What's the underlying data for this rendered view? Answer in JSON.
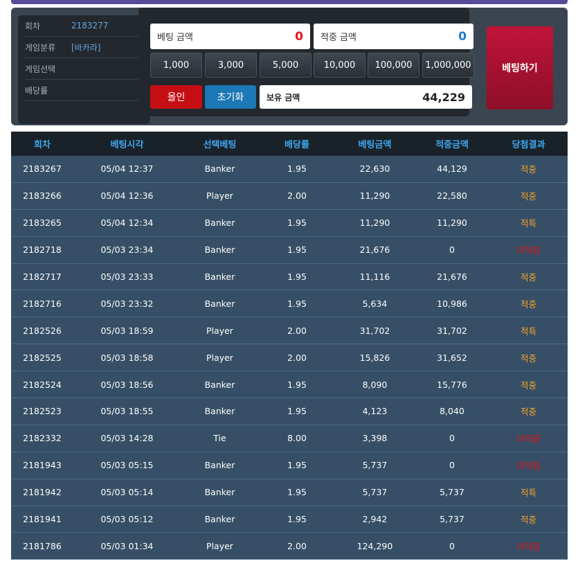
{
  "colors": {
    "accent": "#3ea7f0",
    "win": "#f3a12a",
    "lose": "#e3141e",
    "bet_button": "#b0102f"
  },
  "info": {
    "rows": [
      {
        "label": "회차",
        "value": "2183277"
      },
      {
        "label": "게임분류",
        "value": "[바카라]"
      },
      {
        "label": "게임선택",
        "value": ""
      },
      {
        "label": "배당률",
        "value": ""
      }
    ]
  },
  "bet_amount": {
    "label": "베팅 금액",
    "value": "0"
  },
  "win_amount": {
    "label": "적중 금액",
    "value": "0"
  },
  "chips": [
    "1,000",
    "3,000",
    "5,000",
    "10,000",
    "100,000",
    "1,000,000"
  ],
  "buttons": {
    "allin": "올인",
    "reset": "초기화",
    "place_bet": "베팅하기"
  },
  "holding": {
    "label": "보유 금액",
    "value": "44,229"
  },
  "history": {
    "columns": [
      "회차",
      "베팅시각",
      "선택베팅",
      "배당률",
      "베팅금액",
      "적중금액",
      "당첨결과"
    ],
    "rows": [
      [
        "2183267",
        "05/04 12:37",
        "Banker",
        "1.95",
        "22,630",
        "44,129",
        "적중"
      ],
      [
        "2183266",
        "05/04 12:36",
        "Player",
        "2.00",
        "11,290",
        "22,580",
        "적중"
      ],
      [
        "2183265",
        "05/04 12:34",
        "Banker",
        "1.95",
        "11,290",
        "11,290",
        "적특"
      ],
      [
        "2182718",
        "05/03 23:34",
        "Banker",
        "1.95",
        "21,676",
        "0",
        "미적중"
      ],
      [
        "2182717",
        "05/03 23:33",
        "Banker",
        "1.95",
        "11,116",
        "21,676",
        "적중"
      ],
      [
        "2182716",
        "05/03 23:32",
        "Banker",
        "1.95",
        "5,634",
        "10,986",
        "적중"
      ],
      [
        "2182526",
        "05/03 18:59",
        "Player",
        "2.00",
        "31,702",
        "31,702",
        "적특"
      ],
      [
        "2182525",
        "05/03 18:58",
        "Player",
        "2.00",
        "15,826",
        "31,652",
        "적중"
      ],
      [
        "2182524",
        "05/03 18:56",
        "Banker",
        "1.95",
        "8,090",
        "15,776",
        "적중"
      ],
      [
        "2182523",
        "05/03 18:55",
        "Banker",
        "1.95",
        "4,123",
        "8,040",
        "적중"
      ],
      [
        "2182332",
        "05/03 14:28",
        "Tie",
        "8.00",
        "3,398",
        "0",
        "미적중"
      ],
      [
        "2181943",
        "05/03 05:15",
        "Banker",
        "1.95",
        "5,737",
        "0",
        "미적중"
      ],
      [
        "2181942",
        "05/03 05:14",
        "Banker",
        "1.95",
        "5,737",
        "5,737",
        "적특"
      ],
      [
        "2181941",
        "05/03 05:12",
        "Banker",
        "1.95",
        "2,942",
        "5,737",
        "적중"
      ],
      [
        "2181786",
        "05/03 01:34",
        "Player",
        "2.00",
        "124,290",
        "0",
        "미적중"
      ]
    ]
  }
}
